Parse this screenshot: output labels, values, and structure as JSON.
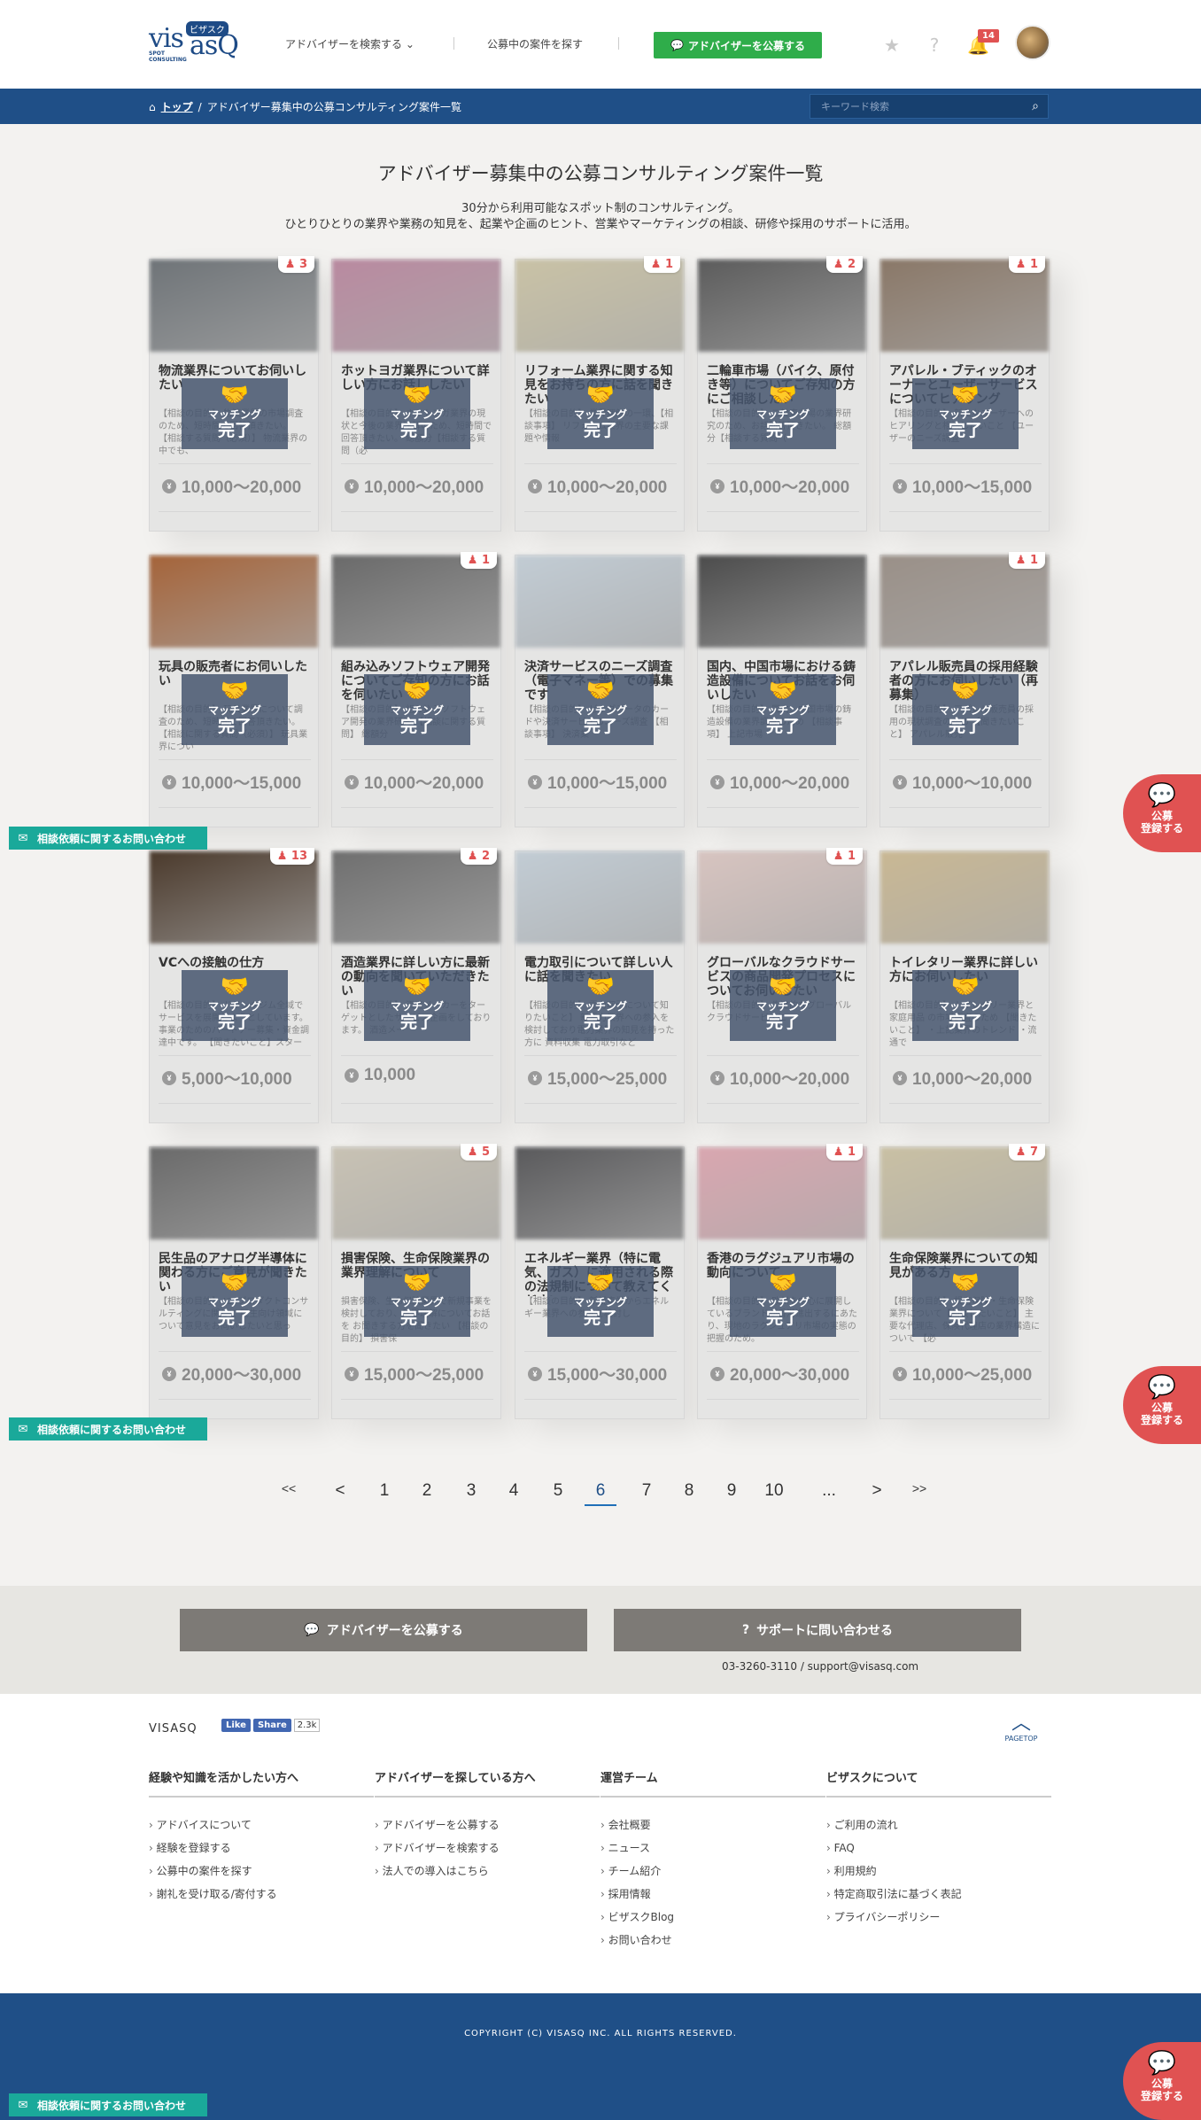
{
  "header": {
    "logo_main": "vis",
    "logo_asq": "asQ",
    "logo_katakana": "ビザスク",
    "logo_sub1": "SPOT",
    "logo_sub2": "CONSULTING",
    "nav_search": "アドバイザーを検索する",
    "nav_projects": "公募中の案件を探す",
    "publish_button": "アドバイザーを公募する",
    "notification_count": "14"
  },
  "breadcrumb": {
    "home": "トップ",
    "separator": "/",
    "current": "アドバイザー募集中の公募コンサルティング案件一覧"
  },
  "search": {
    "placeholder": "キーワード検索"
  },
  "page": {
    "title": "アドバイザー募集中の公募コンサルティング案件一覧",
    "subtitle1": "30分から利用可能なスポット制のコンサルティング。",
    "subtitle2": "ひとりひとりの業界や業務の知見を、起業や企画のヒント、営業やマーケティングの相談、研修や採用のサポートに活用。"
  },
  "overlay": {
    "matching": "マッチング",
    "done": "完了"
  },
  "cards": [
    {
      "title": "物流業界についてお伺いしたい",
      "desc": "【相談の目的】 物流業界の市場調査のため、短時間で回答頂きたい。 【相談する質問（必須）】 物流業界の中でも、",
      "price": "10,000〜20,000",
      "fav": "3",
      "color": "#6f7478"
    },
    {
      "title": "ホットヨガ業界について詳しい方にお話ししたい",
      "desc": "【相談の目的】 ホットヨガ業界の現状と今後の業界理解のため、短時間で回答頂きたい。 総額分【相談する質問（必",
      "price": "10,000〜20,000",
      "fav": "",
      "color": "#b98aa0"
    },
    {
      "title": "リフォーム業界に関する知見をお持ちの方に話を聞きたい",
      "desc": "【相談の目的】 業界理解の一環、【相談事項】 リフォーム業界の主要な課題や情報",
      "price": "10,000〜20,000",
      "fav": "1",
      "color": "#c9c2a6"
    },
    {
      "title": "二輪車市場（バイク、原付き等）についてご存知の方にご相談したい",
      "desc": "【相談の目的】 二輪車市場の業界研究のため、お話回答頂きたい。 総額分【相談する質問（",
      "price": "10,000〜20,000",
      "fav": "2",
      "color": "#5c5c5c"
    },
    {
      "title": "アパレル・ブティックのオーナーとユーザーサービスについてヒアリング",
      "desc": "【相談の目的】 新たなユーザーへのヒアリングと相談したいこと 【ユーザーのニーズ調査",
      "price": "10,000〜15,000",
      "fav": "1",
      "color": "#8a7868"
    },
    {
      "title": "玩具の販売者にお伺いしたい",
      "desc": "【相談の目的】 玩具業界について調査のため、短時間で回答頂きたい。 【相談に関する質問（必須）】 玩具業界につい",
      "price": "10,000〜15,000",
      "fav": "",
      "color": "#a5643a"
    },
    {
      "title": "組み込みソフトウェア開発についてご存知の方にお話を伺いたい",
      "desc": "【相談の目的】 組み込みソフトウェア開発の業界研究 【相談に関する質問】 総額分",
      "price": "10,000〜20,000",
      "fav": "1",
      "color": "#6a6a6a"
    },
    {
      "title": "決済サービスのニーズ調査（電子マネー等）での募集です",
      "desc": "【相談の目的】 ビッグデータのカードや決済サービスのニーズ調査 【相談事項】 決済業",
      "price": "10,000〜15,000",
      "fav": "",
      "color": "#c2ccd4"
    },
    {
      "title": "国内、中国市場における鋳造設備についてお話をお伺いしたい",
      "desc": "【相談の目的】 国内、中国市場の鋳造設備の業界調査のため 【相談事項】 上記市場",
      "price": "10,000〜20,000",
      "fav": "",
      "color": "#4c4c4c"
    },
    {
      "title": "アパレル販売員の採用経験者の方にお伺いしたい（再募集）",
      "desc": "【相談の目的】 アパレル販売員の採用の現状調査のため 【聞きたいこと】 アパレル販売",
      "price": "10,000〜10,000",
      "fav": "1",
      "color": "#9a9088"
    },
    {
      "title": "VCへの接触の仕方",
      "desc": "【相談の目的】 ドリンクジム全域でサービスを展開しようとしています。 事業のためのパートナー募集・資金調達中です。 【聞きたいこと】スタートアッ",
      "price": "5,000〜10,000",
      "fav": "13",
      "color": "#4b3a2c"
    },
    {
      "title": "酒造業界に詳しい方に最新の動向を聞いていただきたい",
      "desc": "【相談の目的】 酒造メーカーをターゲットとしたサービス企画をしております。 酒造メー",
      "price": "10,000",
      "fav": "2",
      "color": "#6f6f6f"
    },
    {
      "title": "電力取引について詳しい人に話を聞きたい",
      "desc": "【相談の目的】 電力取引について知りたいこと】 新電力業界への参入を検討しており電力業界の知見を持った方に 資料収集 電力取引など",
      "price": "15,000〜25,000",
      "fav": "",
      "color": "#c2ccd4"
    },
    {
      "title": "グローバルなクラウドサービスの商品開発プロセスについてお伺いしたい",
      "desc": "【相談の目的】 先進的なグローバルクラウドサービスに",
      "price": "10,000〜20,000",
      "fav": "1",
      "color": "#d7c4c0"
    },
    {
      "title": "トイレタリー業界に詳しい方にお伺いしたい",
      "desc": "【相談の目的】 トイレタリー業界と家庭用品 の市場調査のため 【聞きたいこと】 ・上記業界のトレンド ・流通で",
      "price": "10,000〜20,000",
      "fav": "",
      "color": "#c9b894"
    },
    {
      "title": "民生品のアナログ半導体に関わる方にご意見が聞きたい",
      "desc": "【相談の目的】 ICTプロダクトコンサルティングに関して 民生向け領域について意見をお伺いしたいと思っ",
      "price": "20,000〜30,000",
      "fav": "",
      "color": "#6a6a6a"
    },
    {
      "title": "損害保険、生命保険業界の業界理解について",
      "desc": "損害保険、生命保険業界で新規事業を検討しており、業界理解についてお話を お聞きする方を聞きたい 【相談の目的】 損害保",
      "price": "15,000〜25,000",
      "fav": "5",
      "color": "#c8c2b4"
    },
    {
      "title": "エネルギー業界（特に電気、ガス）に適用される際の法規制について教えてください",
      "desc": "【相談の目的】 新規事業からエネルギー業界への参入を検討し",
      "price": "15,000〜30,000",
      "fav": "",
      "color": "#5a5a5c"
    },
    {
      "title": "香港のラグジュアリ市場の動向について",
      "desc": "【相談の目的】 欧州を中心に展開しているブランドが香港進出するにあたり、現地のラグジュアリ市場の実態の把握のため。",
      "price": "20,000〜30,000",
      "fav": "1",
      "color": "#d9a7b0"
    },
    {
      "title": "生命保険業界についての知見がある方",
      "desc": "【相談の目的】 損害保険・生命保険業界について【相談したいこと】 主要な代理店、保険代理店の業界構造について 【必",
      "price": "10,000〜25,000",
      "fav": "7",
      "color": "#c9c0a4"
    }
  ],
  "pagination": [
    "<<",
    "<",
    "1",
    "2",
    "3",
    "4",
    "5",
    "6",
    "7",
    "8",
    "9",
    "10",
    "...",
    ">",
    ">>"
  ],
  "pagination_active": "6",
  "cta": {
    "publish": "アドバイザーを公募する",
    "support": "サポートに問い合わせる",
    "contact": "03-3260-3110 / support@visasq.com"
  },
  "footer": {
    "brand": "VISASQ",
    "like": "Like",
    "share": "Share",
    "count": "2.3k",
    "pagetop": "PAGETOP",
    "columns": [
      {
        "heading": "経験や知識を活かしたい方へ",
        "links": [
          "アドバイスについて",
          "経験を登録する",
          "公募中の案件を探す",
          "謝礼を受け取る/寄付する"
        ]
      },
      {
        "heading": "アドバイザーを探している方へ",
        "links": [
          "アドバイザーを公募する",
          "アドバイザーを検索する",
          "法人での導入はこちら"
        ]
      },
      {
        "heading": "運営チーム",
        "links": [
          "会社概要",
          "ニュース",
          "チーム紹介",
          "採用情報",
          "ビザスクBlog",
          "お問い合わせ"
        ]
      },
      {
        "heading": "ビザスクについて",
        "links": [
          "ご利用の流れ",
          "FAQ",
          "利用規約",
          "特定商取引法に基づく表記",
          "プライバシーポリシー"
        ]
      }
    ],
    "copyright": "COPYRIGHT (C) VISASQ INC. ALL RIGHTS RESERVED."
  },
  "side": {
    "contact": "相談依頼に関するお問い合わせ",
    "register1": "公募",
    "register2": "登録する"
  }
}
